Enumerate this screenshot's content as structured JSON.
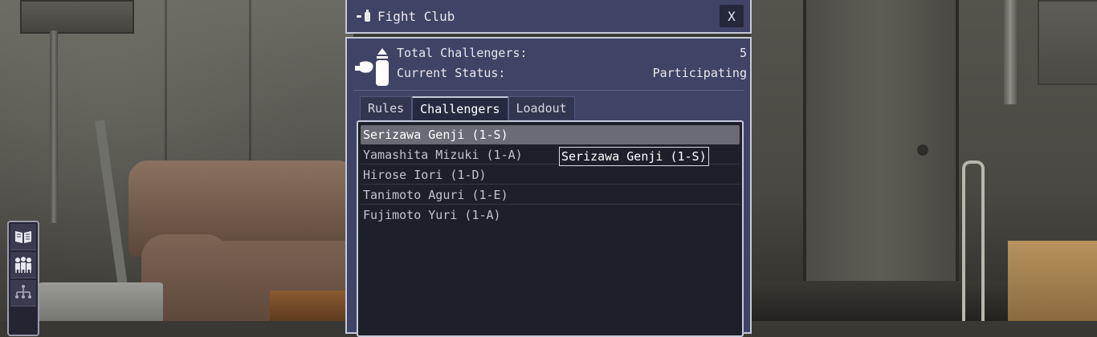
{
  "window": {
    "title": "Fight Club",
    "close_label": "X"
  },
  "summary": {
    "total_challengers_label": "Total Challengers:",
    "total_challengers_value": "5",
    "current_status_label": "Current Status:",
    "current_status_value": "Participating"
  },
  "tabs": [
    {
      "label": "Rules",
      "active": false
    },
    {
      "label": "Challengers",
      "active": true
    },
    {
      "label": "Loadout",
      "active": false
    }
  ],
  "challengers": [
    {
      "label": "Serizawa Genji (1-S)",
      "selected": true
    },
    {
      "label": "Yamashita Mizuki (1-A)",
      "selected": false
    },
    {
      "label": "Hirose Iori (1-D)",
      "selected": false
    },
    {
      "label": "Tanimoto Aguri (1-E)",
      "selected": false
    },
    {
      "label": "Fujimoto Yuri (1-A)",
      "selected": false
    }
  ],
  "tooltip": {
    "text": "Serizawa Genji (1-S)"
  },
  "toolbar": {
    "icons": [
      "map-icon",
      "group-icon",
      "hierarchy-icon"
    ]
  },
  "colors": {
    "panel_bg": "#3f4365",
    "panel_border": "#c6c9d8",
    "list_bg": "#1d1f2a",
    "selected_row": "#6a6b75"
  }
}
